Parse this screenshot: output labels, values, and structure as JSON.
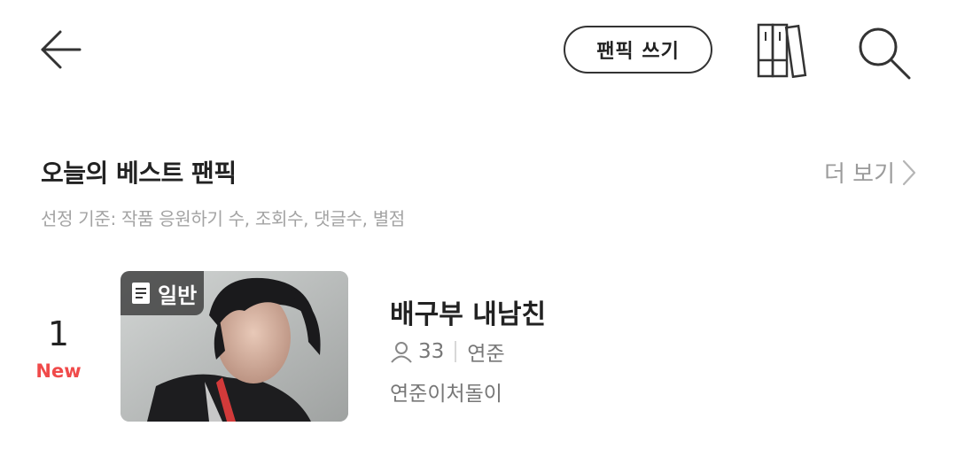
{
  "header": {
    "write_button_label": "팬픽 쓰기",
    "icons": [
      "back-arrow-icon",
      "bookshelf-icon",
      "search-icon"
    ]
  },
  "section": {
    "title": "오늘의 베스트 팬픽",
    "more_label": "더 보기",
    "criteria": "선정 기준: 작품 응원하기 수, 조회수, 댓글수, 별점"
  },
  "items": [
    {
      "rank": "1",
      "badge": "New",
      "tag": "일반",
      "title": "배구부 내남친",
      "count": "33",
      "character": "연준",
      "author": "연준이처돌이"
    }
  ],
  "colors": {
    "new_badge": "#f04a4a",
    "muted_text": "#a3a3a3",
    "primary_text": "#222222"
  }
}
